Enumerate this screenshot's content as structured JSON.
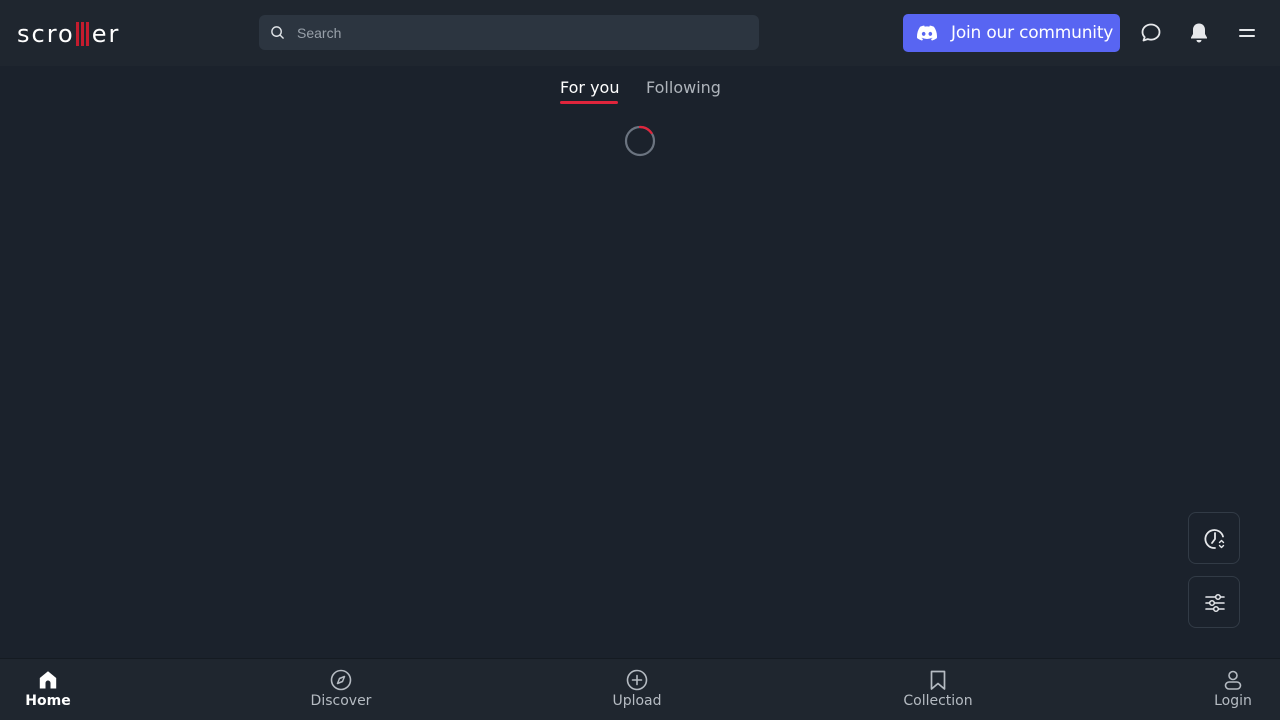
{
  "header": {
    "logo_text_left": "scro",
    "logo_text_right": "er",
    "search_placeholder": "Search",
    "community_button": "Join our community"
  },
  "tabs": [
    {
      "label": "For you",
      "active": true
    },
    {
      "label": "Following",
      "active": false
    }
  ],
  "bottom_nav": [
    {
      "label": "Home",
      "icon": "home-icon",
      "active": true
    },
    {
      "label": "Discover",
      "icon": "compass-icon",
      "active": false
    },
    {
      "label": "Upload",
      "icon": "plus-circle-icon",
      "active": false
    },
    {
      "label": "Collection",
      "icon": "bookmark-icon",
      "active": false
    },
    {
      "label": "Login",
      "icon": "user-icon",
      "active": false
    }
  ],
  "colors": {
    "background": "#1b222c",
    "header": "#1f262f",
    "accent": "#e0253c",
    "discord": "#5865f2"
  }
}
